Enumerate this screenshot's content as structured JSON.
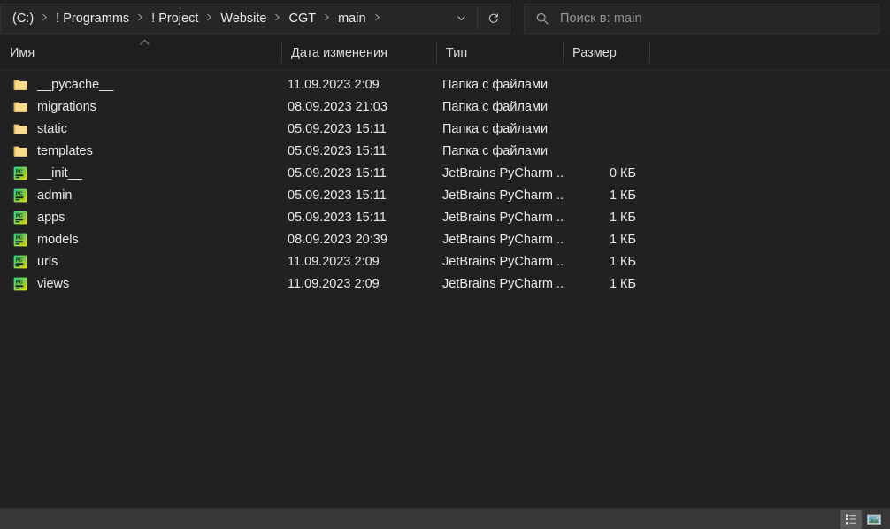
{
  "window": {
    "title": "main",
    "theme_background": "#202020",
    "content_background": "#212121",
    "statusbar_background": "#373737",
    "accent_text": "#e8e8e8"
  },
  "addressbar": {
    "breadcrumbs": [
      {
        "label": "(C:)"
      },
      {
        "label": "! Programms"
      },
      {
        "label": "! Project"
      },
      {
        "label": "Website"
      },
      {
        "label": "CGT"
      },
      {
        "label": "main"
      }
    ],
    "separator_icon": "chevron-right-icon",
    "history_icon": "chevron-down-icon",
    "refresh_icon": "refresh-icon"
  },
  "search": {
    "icon": "search-icon",
    "placeholder": "Поиск в: main",
    "placeholder_prefix": "Поиск в: ",
    "placeholder_scope": "main",
    "value": ""
  },
  "columns": [
    {
      "key": "name",
      "label": "Имя",
      "sorted": true,
      "sort_direction": "ascending"
    },
    {
      "key": "date",
      "label": "Дата изменения"
    },
    {
      "key": "type",
      "label": "Тип"
    },
    {
      "key": "size",
      "label": "Размер"
    }
  ],
  "files": [
    {
      "name": "__pycache__",
      "date": "11.09.2023 2:09",
      "type": "Папка с файлами",
      "size": "",
      "icon": "folder-icon"
    },
    {
      "name": "migrations",
      "date": "08.09.2023 21:03",
      "type": "Папка с файлами",
      "size": "",
      "icon": "folder-icon"
    },
    {
      "name": "static",
      "date": "05.09.2023 15:11",
      "type": "Папка с файлами",
      "size": "",
      "icon": "folder-icon"
    },
    {
      "name": "templates",
      "date": "05.09.2023 15:11",
      "type": "Папка с файлами",
      "size": "",
      "icon": "folder-icon"
    },
    {
      "name": "__init__",
      "date": "05.09.2023 15:11",
      "type": "JetBrains PyCharm ...",
      "size": "0 КБ",
      "icon": "pycharm-file-icon"
    },
    {
      "name": "admin",
      "date": "05.09.2023 15:11",
      "type": "JetBrains PyCharm ...",
      "size": "1 КБ",
      "icon": "pycharm-file-icon"
    },
    {
      "name": "apps",
      "date": "05.09.2023 15:11",
      "type": "JetBrains PyCharm ...",
      "size": "1 КБ",
      "icon": "pycharm-file-icon"
    },
    {
      "name": "models",
      "date": "08.09.2023 20:39",
      "type": "JetBrains PyCharm ...",
      "size": "1 КБ",
      "icon": "pycharm-file-icon"
    },
    {
      "name": "urls",
      "date": "11.09.2023 2:09",
      "type": "JetBrains PyCharm ...",
      "size": "1 КБ",
      "icon": "pycharm-file-icon"
    },
    {
      "name": "views",
      "date": "11.09.2023 2:09",
      "type": "JetBrains PyCharm ...",
      "size": "1 КБ",
      "icon": "pycharm-file-icon"
    }
  ],
  "statusbar": {
    "text": "",
    "views": [
      {
        "name": "details-view",
        "icon": "details-view-icon",
        "active": true
      },
      {
        "name": "thumbnail-view",
        "icon": "thumbnail-view-icon",
        "active": false
      }
    ]
  }
}
